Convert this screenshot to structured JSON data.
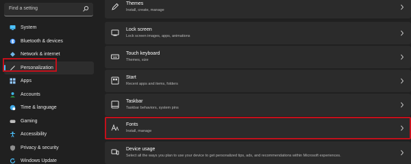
{
  "search": {
    "placeholder": "Find a setting"
  },
  "sidebar": {
    "items": [
      {
        "label": "System",
        "icon": "monitor-icon"
      },
      {
        "label": "Bluetooth & devices",
        "icon": "bluetooth-icon"
      },
      {
        "label": "Network & internet",
        "icon": "wifi-icon"
      },
      {
        "label": "Personalization",
        "icon": "brush-icon",
        "active": true
      },
      {
        "label": "Apps",
        "icon": "apps-icon"
      },
      {
        "label": "Accounts",
        "icon": "person-icon"
      },
      {
        "label": "Time & language",
        "icon": "globe-clock-icon"
      },
      {
        "label": "Gaming",
        "icon": "gamepad-icon"
      },
      {
        "label": "Accessibility",
        "icon": "accessibility-icon"
      },
      {
        "label": "Privacy & security",
        "icon": "shield-icon"
      },
      {
        "label": "Windows Update",
        "icon": "update-icon"
      }
    ]
  },
  "settings": [
    {
      "title": "Themes",
      "subtitle": "Install, create, manage",
      "icon": "pen-icon"
    },
    {
      "title": "Lock screen",
      "subtitle": "Lock screen images, apps, animations",
      "icon": "lock-screen-icon"
    },
    {
      "title": "Touch keyboard",
      "subtitle": "Themes, size",
      "icon": "keyboard-icon"
    },
    {
      "title": "Start",
      "subtitle": "Recent apps and items, folders",
      "icon": "start-icon"
    },
    {
      "title": "Taskbar",
      "subtitle": "Taskbar behaviors, system pins",
      "icon": "taskbar-icon"
    },
    {
      "title": "Fonts",
      "subtitle": "Install, manage",
      "icon": "fonts-icon"
    },
    {
      "title": "Device usage",
      "subtitle": "Select all the ways you plan to use your device to get personalized tips, ads, and recommendations within Microsoft experiences.",
      "icon": "device-usage-icon"
    }
  ],
  "colors": {
    "accent": "#4cc2ff",
    "highlight": "#c4101b",
    "card": "#2b2b2b",
    "background": "#202020"
  }
}
